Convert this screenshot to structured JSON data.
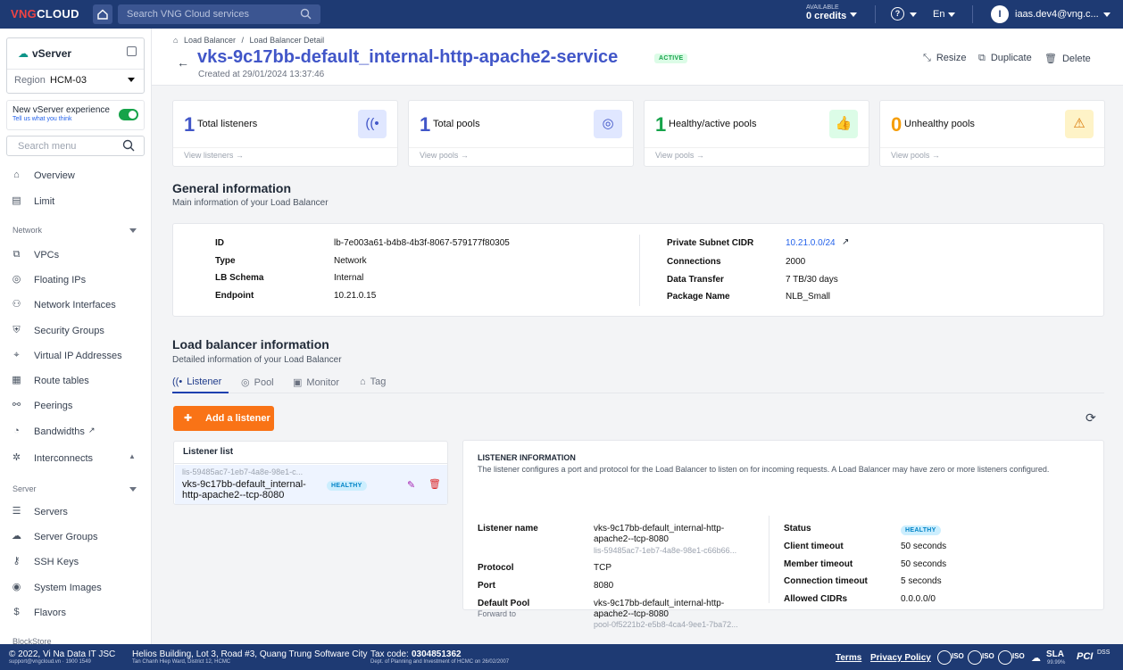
{
  "topbar": {
    "logo_a": "VNG",
    "logo_b": "CLOUD",
    "search_placeholder": "Search VNG Cloud services",
    "credits_label": "AVAILABLE",
    "credits_value": "0 credits",
    "language": "En",
    "avatar_letter": "I",
    "user": "iaas.dev4@vng.c..."
  },
  "sidebar": {
    "service": "vServer",
    "region_label": "Region",
    "region_value": "HCM-03",
    "newexp_label": "New vServer experience",
    "newexp_link": "Tell us what you think",
    "search_placeholder": "Search menu",
    "overview": "Overview",
    "limit": "Limit",
    "network_section": "Network",
    "vpcs": "VPCs",
    "floating_ips": "Floating IPs",
    "network_interfaces": "Network Interfaces",
    "security_groups": "Security Groups",
    "virtual_ip": "Virtual IP Addresses",
    "route_tables": "Route tables",
    "peerings": "Peerings",
    "bandwidths": "Bandwidths",
    "interconnects": "Interconnects",
    "server_section": "Server",
    "servers": "Servers",
    "server_groups": "Server Groups",
    "ssh_keys": "SSH Keys",
    "system_images": "System Images",
    "flavors": "Flavors",
    "blockstore_section": "BlockStore"
  },
  "header": {
    "bc_1": "Load Balancer",
    "bc_sep": "/",
    "bc_2": "Load Balancer Detail",
    "title": "vks-9c17bb-default_internal-http-apache2-service",
    "status": "ACTIVE",
    "created": "Created at 29/01/2024 13:37:46",
    "resize": "Resize",
    "duplicate": "Duplicate",
    "delete": "Delete"
  },
  "cards": [
    {
      "num": "1",
      "label": "Total listeners",
      "view": "View listeners →",
      "color": "#4156c8"
    },
    {
      "num": "1",
      "label": "Total pools",
      "view": "View pools →",
      "color": "#4156c8"
    },
    {
      "num": "1",
      "label": "Healthy/active pools",
      "view": "View pools →",
      "color": "#16a34a"
    },
    {
      "num": "0",
      "label": "Unhealthy pools",
      "view": "View pools →",
      "color": "#f59e0b"
    }
  ],
  "general": {
    "title": "General information",
    "subtitle": "Main information of your Load Balancer",
    "id_l": "ID",
    "id_v": "lb-7e003a61-b4b8-4b3f-8067-579177f80305",
    "type_l": "Type",
    "type_v": "Network",
    "schema_l": "LB Schema",
    "schema_v": "Internal",
    "endpoint_l": "Endpoint",
    "endpoint_v": "10.21.0.15",
    "subnet_l": "Private Subnet CIDR",
    "subnet_v": "10.21.0.0/24",
    "conn_l": "Connections",
    "conn_v": "2000",
    "transfer_l": "Data Transfer",
    "transfer_v": "7 TB/30 days",
    "package_l": "Package Name",
    "package_v": "NLB_Small"
  },
  "lbinfo": {
    "title": "Load balancer information",
    "subtitle": "Detailed information of your Load Balancer",
    "tabs": [
      "Listener",
      "Pool",
      "Monitor",
      "Tag"
    ],
    "add_button": "Add a listener"
  },
  "listener_list": {
    "header": "Listener list",
    "item_id": "lis-59485ac7-1eb7-4a8e-98e1-c...",
    "item_name": "vks-9c17bb-default_internal-http-apache2--tcp-8080",
    "item_status": "HEALTHY"
  },
  "listener_info": {
    "title": "LISTENER INFORMATION",
    "desc": "The listener configures a port and protocol for the Load Balancer to listen on for incoming requests. A Load Balancer may have zero or more listeners configured.",
    "name_l": "Listener name",
    "name_v": "vks-9c17bb-default_internal-http-apache2--tcp-8080",
    "name_id": "lis-59485ac7-1eb7-4a8e-98e1-c66b66...",
    "protocol_l": "Protocol",
    "protocol_v": "TCP",
    "port_l": "Port",
    "port_v": "8080",
    "pool_l": "Default Pool",
    "pool_sub": "Forward to",
    "pool_v": "vks-9c17bb-default_internal-http-apache2--tcp-8080",
    "pool_id": "pool-0f5221b2-e5b8-4ca4-9ee1-7ba72...",
    "status_l": "Status",
    "status_v": "HEALTHY",
    "client_l": "Client timeout",
    "client_v": "50 seconds",
    "member_l": "Member timeout",
    "member_v": "50 seconds",
    "connto_l": "Connection timeout",
    "connto_v": "5 seconds",
    "cidr_l": "Allowed CIDRs",
    "cidr_v": "0.0.0.0/0"
  },
  "footer": {
    "copyright": "© 2022, Vi Na Data IT JSC",
    "support": "support@vngcloud.vn · 1900 1549",
    "address": "Helios Building, Lot 3, Road #3, Quang Trung Software City",
    "address2": "Tan Chanh Hiep Ward, District 12, HCMC",
    "tax": "Tax code:",
    "tax_v": "0304851362",
    "dept": "Dept. of Planning and Investment of HCMC on 26/02/2007",
    "terms": "Terms",
    "privacy": "Privacy Policy",
    "iso": "ISO",
    "sla": "SLA",
    "sla_v": "99.99%",
    "pci": "PCI",
    "dss": "DSS"
  }
}
